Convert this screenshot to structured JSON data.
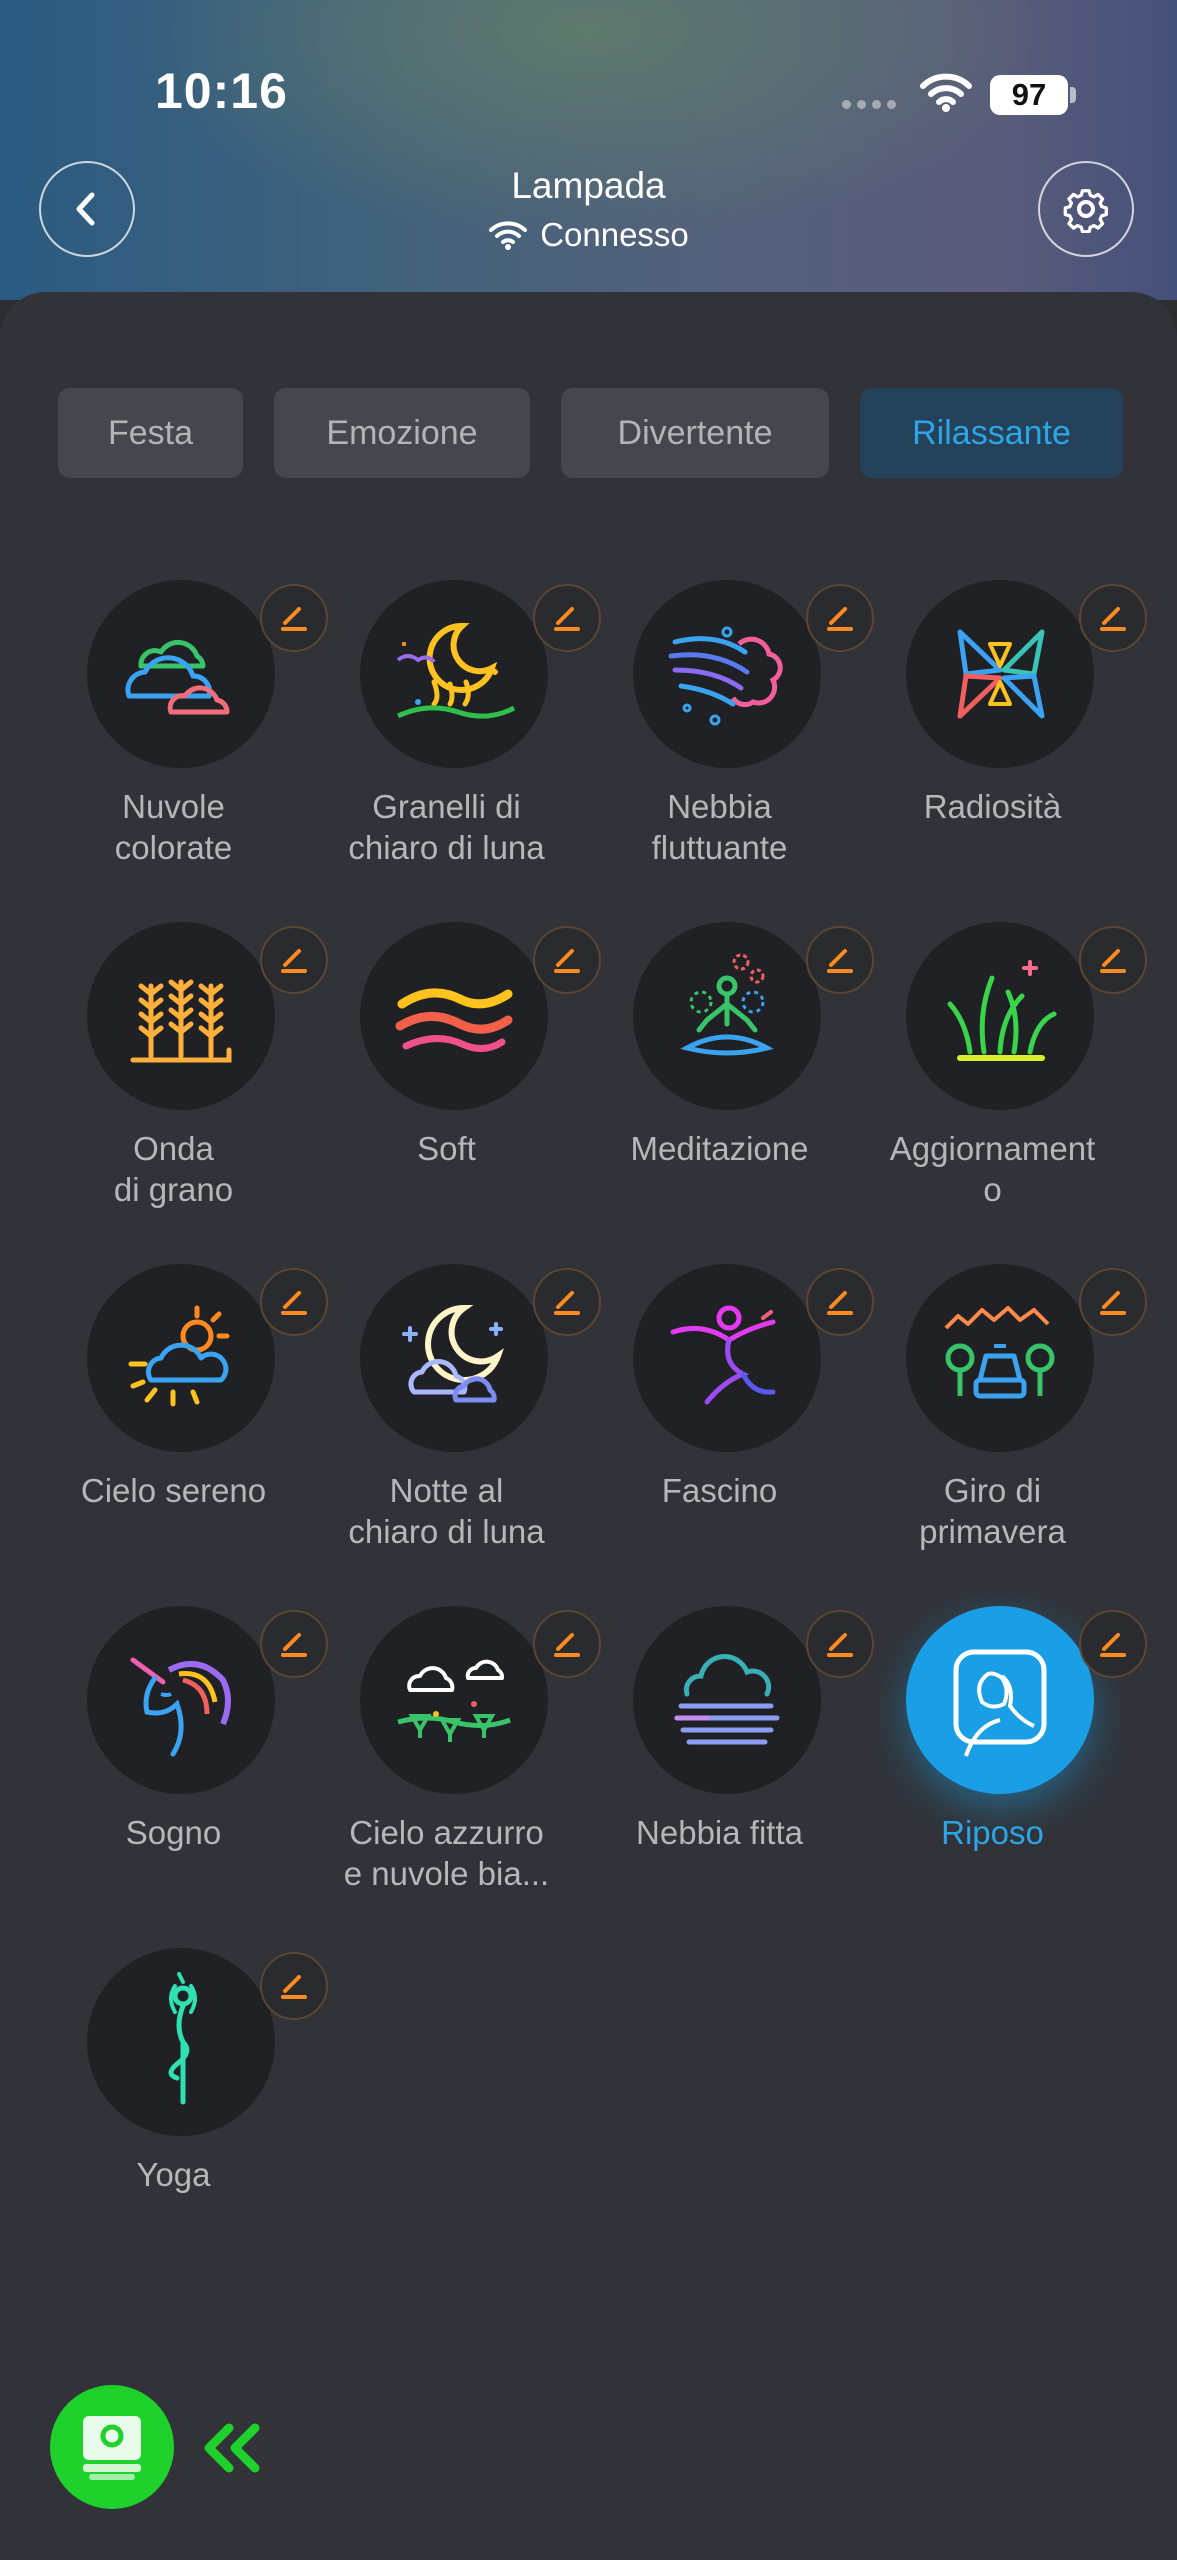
{
  "status_bar": {
    "time": "10:16",
    "battery": "97"
  },
  "header": {
    "title": "Lampada",
    "connection": "Connesso"
  },
  "tabs": [
    {
      "label": "Festa",
      "active": false
    },
    {
      "label": "Emozione",
      "active": false
    },
    {
      "label": "Divertente",
      "active": false
    },
    {
      "label": "Rilassante",
      "active": true
    }
  ],
  "scenes": [
    {
      "label": "Nuvole\ncolorate",
      "icon": "colorful-clouds-icon"
    },
    {
      "label": "Granelli di\nchiaro di luna",
      "icon": "moonlight-icon"
    },
    {
      "label": "Nebbia\nfluttuante",
      "icon": "floating-mist-icon"
    },
    {
      "label": "Radiosità",
      "icon": "radiance-icon"
    },
    {
      "label": "Onda\ndi grano",
      "icon": "wheat-icon"
    },
    {
      "label": "Soft",
      "icon": "soft-waves-icon"
    },
    {
      "label": "Meditazione",
      "icon": "meditation-icon"
    },
    {
      "label": "Aggiornament\no",
      "icon": "grass-icon"
    },
    {
      "label": "Cielo sereno",
      "icon": "sunny-cloud-icon"
    },
    {
      "label": "Notte al\nchiaro di luna",
      "icon": "moon-night-icon"
    },
    {
      "label": "Fascino",
      "icon": "dancer-icon"
    },
    {
      "label": "Giro di\nprimavera",
      "icon": "spring-drive-icon"
    },
    {
      "label": "Sogno",
      "icon": "unicorn-icon"
    },
    {
      "label": "Cielo azzurro\ne nuvole bia...",
      "icon": "blue-sky-icon"
    },
    {
      "label": "Nebbia fitta",
      "icon": "dense-fog-icon"
    },
    {
      "label": "Riposo",
      "icon": "rest-icon",
      "active": true
    },
    {
      "label": "Yoga",
      "icon": "yoga-icon"
    }
  ],
  "colors": {
    "accent": "#2ea5e6",
    "fab": "#1fd12b",
    "edit": "#ff8a1f"
  }
}
